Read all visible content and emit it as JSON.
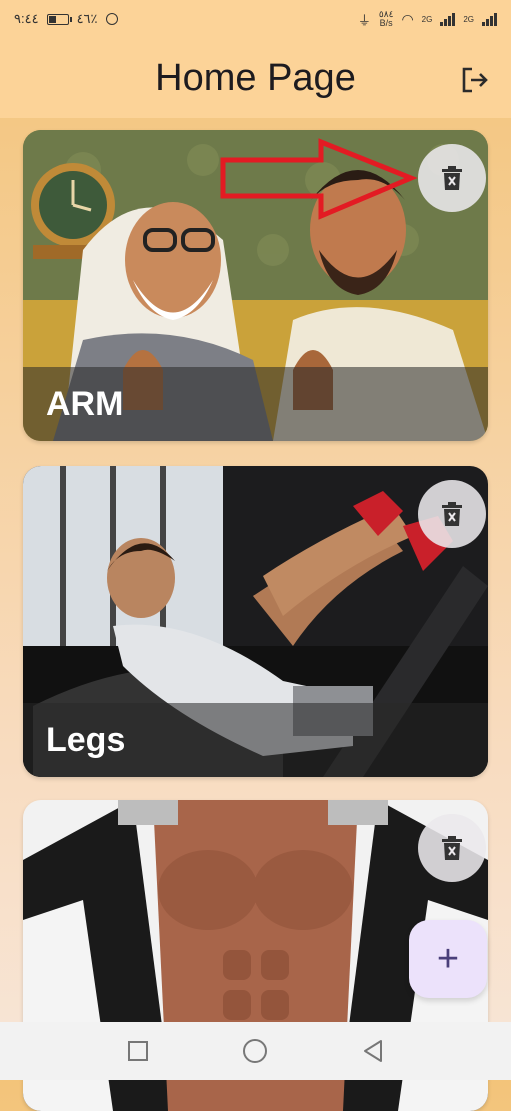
{
  "status_bar": {
    "time": "٩:٤٤",
    "battery_percent": "٤٦٪",
    "battery_level": 0.46,
    "net_speed": "٥٨٤",
    "net_unit": "B/s",
    "sim1": "2G",
    "sim2": "2G"
  },
  "header": {
    "title": "Home Page"
  },
  "cards": [
    {
      "label": "ARM"
    },
    {
      "label": "Legs"
    },
    {
      "label": ""
    }
  ],
  "fab": {
    "label": "+"
  },
  "colors": {
    "header_bg": "#fcd398",
    "fab_bg": "#ece2fb",
    "arrow": "#e31b23"
  },
  "icons": {
    "logout": "logout-icon",
    "delete": "trash-icon",
    "add": "plus-icon"
  }
}
